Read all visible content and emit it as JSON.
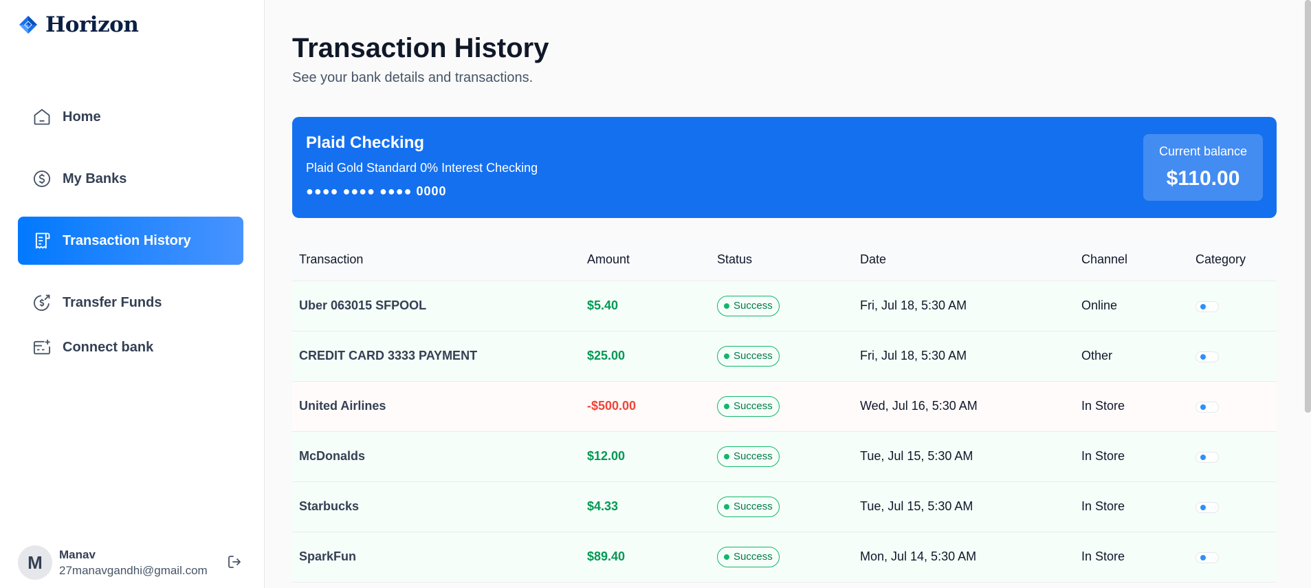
{
  "app": {
    "name": "Horizon"
  },
  "sidebar": {
    "items": [
      {
        "label": "Home",
        "icon": "home-icon",
        "active": false
      },
      {
        "label": "My Banks",
        "icon": "dollar-circle-icon",
        "active": false
      },
      {
        "label": "Transaction History",
        "icon": "receipt-icon",
        "active": true
      },
      {
        "label": "Transfer Funds",
        "icon": "money-send-icon",
        "active": false
      },
      {
        "label": "Connect bank",
        "icon": "connect-bank-icon",
        "active": false
      }
    ],
    "user": {
      "initial": "M",
      "name": "Manav",
      "email": "27manavgandhi@gmail.com"
    }
  },
  "header": {
    "title": "Transaction History",
    "subtitle": "See your bank details and transactions."
  },
  "bank_card": {
    "name": "Plaid Checking",
    "official_name": "Plaid Gold Standard 0% Interest Checking",
    "mask": "●●●● ●●●● ●●●● 0000",
    "balance_label": "Current balance",
    "balance": "$110.00"
  },
  "table": {
    "columns": [
      "Transaction",
      "Amount",
      "Status",
      "Date",
      "Channel",
      "Category"
    ],
    "rows": [
      {
        "name": "Uber 063015 SFPOOL",
        "amount": "$5.40",
        "status": "Success",
        "date": "Fri, Jul 18, 5:30 AM",
        "channel": "Online"
      },
      {
        "name": "CREDIT CARD 3333 PAYMENT",
        "amount": "$25.00",
        "status": "Success",
        "date": "Fri, Jul 18, 5:30 AM",
        "channel": "Other"
      },
      {
        "name": "United Airlines",
        "amount": "-$500.00",
        "status": "Success",
        "date": "Wed, Jul 16, 5:30 AM",
        "channel": "In Store"
      },
      {
        "name": "McDonalds",
        "amount": "$12.00",
        "status": "Success",
        "date": "Tue, Jul 15, 5:30 AM",
        "channel": "In Store"
      },
      {
        "name": "Starbucks",
        "amount": "$4.33",
        "status": "Success",
        "date": "Tue, Jul 15, 5:30 AM",
        "channel": "In Store"
      },
      {
        "name": "SparkFun",
        "amount": "$89.40",
        "status": "Success",
        "date": "Mon, Jul 14, 5:30 AM",
        "channel": "In Store"
      }
    ]
  },
  "colors": {
    "accent": "#1570ef",
    "positive": "#039855",
    "negative": "#f04438",
    "success": "#12b76a"
  }
}
